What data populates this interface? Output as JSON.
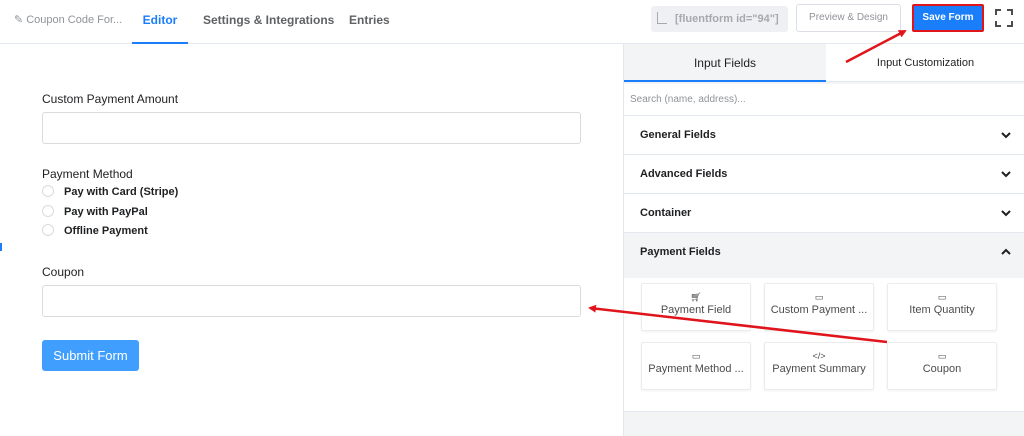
{
  "header": {
    "form_title": "Coupon Code For...",
    "tabs": [
      "Editor",
      "Settings & Integrations",
      "Entries"
    ],
    "shortcode": "[fluentform id=\"94\"]",
    "preview_label": "Preview & Design",
    "save_label": "Save Form",
    "fullscreen_icon": "fullscreen-icon"
  },
  "form": {
    "custom_amount_label": "Custom Payment Amount",
    "payment_method_label": "Payment Method",
    "payment_options": [
      "Pay with Card (Stripe)",
      "Pay with PayPal",
      "Offline Payment"
    ],
    "coupon_label": "Coupon",
    "submit_label": "Submit Form"
  },
  "sidebar": {
    "tabs": [
      "Input Fields",
      "Input Customization"
    ],
    "search_placeholder": "Search (name, address)...",
    "sections": [
      "General Fields",
      "Advanced Fields",
      "Container",
      "Payment Fields"
    ],
    "payment_cards": [
      {
        "label": "Payment Field",
        "icon": "cart-icon"
      },
      {
        "label": "Custom Payment ...",
        "icon": "card-icon"
      },
      {
        "label": "Item Quantity",
        "icon": "card-icon"
      },
      {
        "label": "Payment Method ...",
        "icon": "card-icon"
      },
      {
        "label": "Payment Summary",
        "icon": "code-icon"
      },
      {
        "label": "Coupon",
        "icon": "coupon-icon"
      }
    ]
  },
  "colors": {
    "accent": "#1a7efb",
    "submit": "#409eff",
    "annotation": "#e0141b"
  }
}
